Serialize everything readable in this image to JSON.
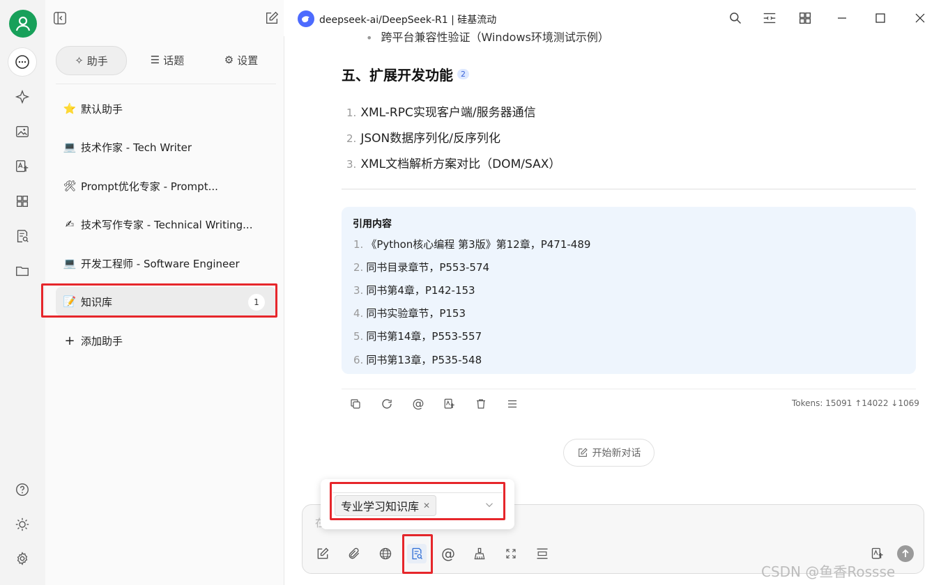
{
  "window": {
    "title": "deepseek-ai/DeepSeek-R1 | 硅基流动"
  },
  "sidebar": {
    "tabs": [
      {
        "label": "助手",
        "icon": "sparkle-icon"
      },
      {
        "label": "话题",
        "icon": "list-icon"
      },
      {
        "label": "设置",
        "icon": "gear-icon"
      }
    ],
    "assistants": [
      {
        "emoji": "⭐",
        "label": "默认助手"
      },
      {
        "emoji": "💻",
        "label": "技术作家 - Tech Writer"
      },
      {
        "emoji": "🛠",
        "label": "Prompt优化专家 - Prompt..."
      },
      {
        "emoji": "✍",
        "label": "技术写作专家 - Technical Writing..."
      },
      {
        "emoji": "💻",
        "label": "开发工程师 - Software Engineer"
      },
      {
        "emoji": "📝",
        "label": "知识库",
        "badge": "1"
      }
    ],
    "add_label": "添加助手"
  },
  "message": {
    "partial_bullet": "跨平台兼容性验证（Windows环境测试示例）",
    "heading": "五、扩展开发功能",
    "heading_cite": "2",
    "list": [
      {
        "n": "1.",
        "text": "XML-RPC实现客户端/服务器通信"
      },
      {
        "n": "2.",
        "text": "JSON数据序列化/反序列化"
      },
      {
        "n": "3.",
        "text": "XML文档解析方案对比（DOM/SAX）"
      }
    ],
    "references": {
      "title": "引用内容",
      "items": [
        {
          "n": "1.",
          "text": "《Python核心编程 第3版》第12章，P471-489"
        },
        {
          "n": "2.",
          "text": "同书目录章节，P553-574"
        },
        {
          "n": "3.",
          "text": "同书第4章，P142-153"
        },
        {
          "n": "4.",
          "text": "同书实验章节，P153"
        },
        {
          "n": "5.",
          "text": "同书第14章，P553-557"
        },
        {
          "n": "6.",
          "text": "同书第13章，P535-548"
        }
      ]
    },
    "tokens": "Tokens: 15091 ↑14022 ↓1069"
  },
  "new_chat_label": "开始新对话",
  "kb_popup": {
    "selected_tag": "专业学习知识库",
    "input_hint": "在"
  },
  "watermark": "CSDN @鱼香Rossse",
  "colors": {
    "accent_green": "#18a05a",
    "highlight_red": "#e6262b",
    "ref_bg": "#eef5fd"
  }
}
